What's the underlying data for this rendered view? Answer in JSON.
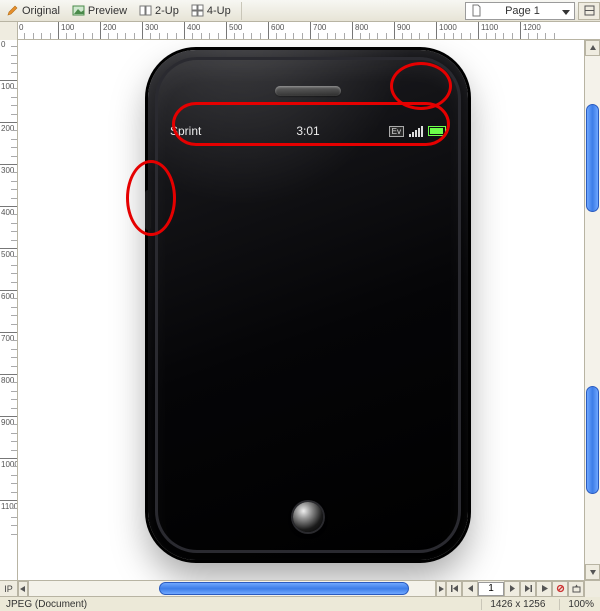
{
  "toolbar": {
    "views": {
      "original": "Original",
      "preview": "Preview",
      "two_up": "2-Up",
      "four_up": "4-Up"
    },
    "page_selector": {
      "label": "Page 1"
    }
  },
  "ruler": {
    "h_ticks": [
      0,
      100,
      200,
      300,
      400,
      500,
      600,
      700,
      800,
      900,
      1000,
      1100,
      1200
    ],
    "v_ticks": [
      0,
      100,
      200,
      300,
      400,
      500,
      600,
      700,
      800,
      900,
      1000,
      1100
    ]
  },
  "phone": {
    "carrier": "Sprint",
    "time": "3:01",
    "network_badge": "Ev"
  },
  "nav": {
    "page_input": "1"
  },
  "bottom_label": "IP",
  "status": {
    "doc_type": "JPEG (Document)",
    "dimensions": "1426 x 1256",
    "zoom": "100%"
  }
}
